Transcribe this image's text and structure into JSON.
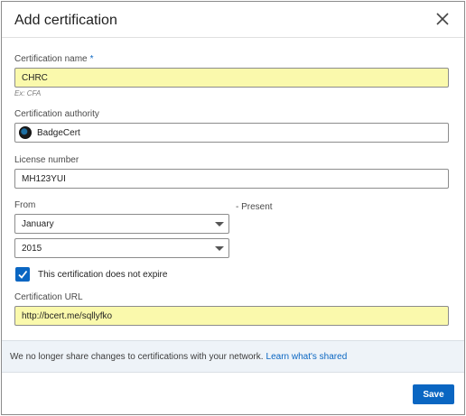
{
  "dialog": {
    "title": "Add certification",
    "close_icon": "close-icon"
  },
  "form": {
    "name": {
      "label": "Certification name",
      "required_marker": "*",
      "value": "CHRC",
      "hint": "Ex: CFA"
    },
    "authority": {
      "label": "Certification authority",
      "value": "BadgeCert",
      "logo_icon": "badgecert-logo-icon"
    },
    "license": {
      "label": "License number",
      "value": "MH123YUI"
    },
    "from": {
      "label": "From",
      "month": "January",
      "year": "2015",
      "to_text": "- Present"
    },
    "no_expire": {
      "checked": true,
      "label": "This certification does not expire"
    },
    "url": {
      "label": "Certification URL",
      "value": "http://bcert.me/sqllyfko"
    }
  },
  "info": {
    "text": "We no longer share changes to certifications with your network.",
    "link": "Learn what's shared"
  },
  "footer": {
    "save_label": "Save"
  },
  "colors": {
    "accent": "#0a66c2",
    "highlight": "#faf9ac",
    "info_bg": "#eef3f8"
  }
}
